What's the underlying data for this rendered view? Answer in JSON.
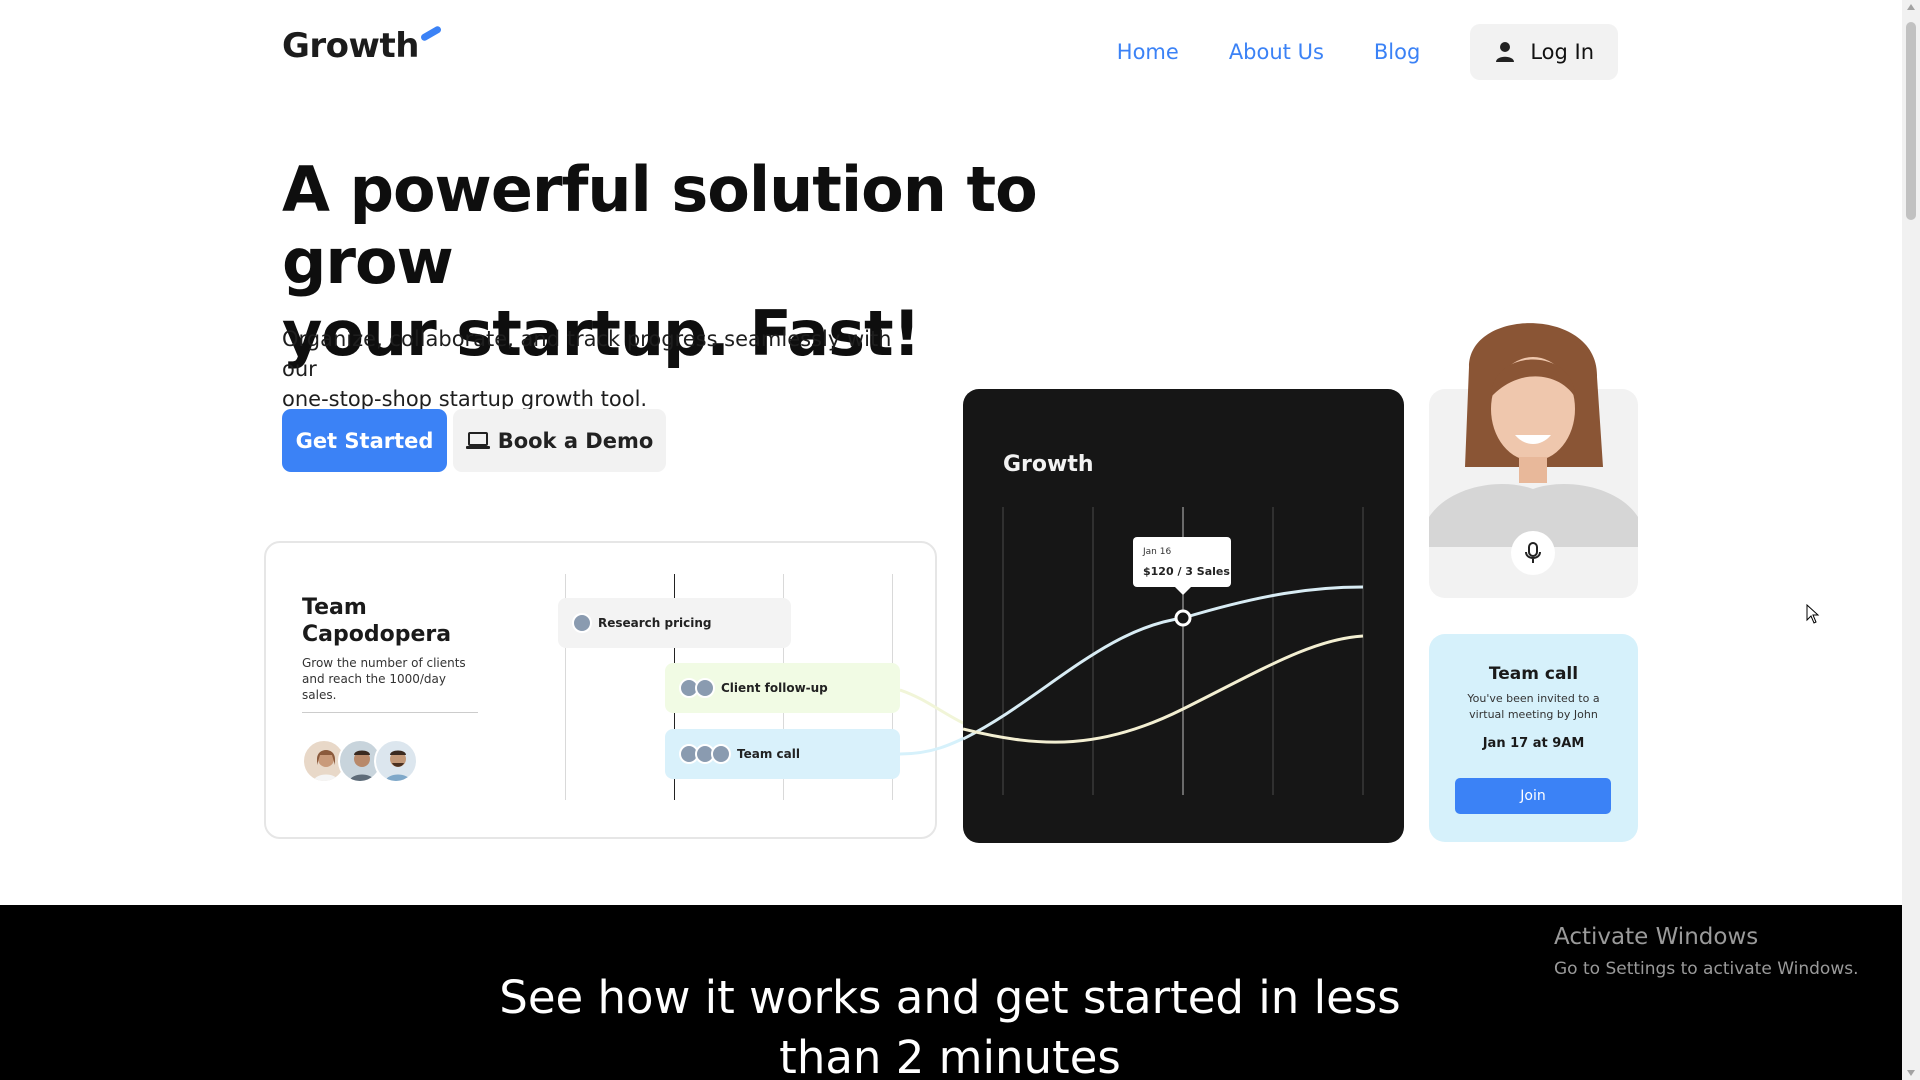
{
  "header": {
    "logo": "Growth",
    "nav": [
      "Home",
      "About Us",
      "Blog"
    ],
    "login_label": "Log In"
  },
  "hero": {
    "title_line1": "A powerful solution to grow",
    "title_line2": "your startup. Fast!",
    "subtitle_line1": "Organize, collaborate, and track progress seamlessly with our",
    "subtitle_line2": "one-stop-shop startup growth tool.",
    "primary_button": "Get Started",
    "secondary_button": "Book a Demo"
  },
  "team_card": {
    "title": "Team Capodopera",
    "description": "Grow the number of clients and reach the 1000/day sales.",
    "tasks": [
      "Research pricing",
      "Client follow-up",
      "Team call"
    ]
  },
  "growth_card": {
    "title": "Growth",
    "tooltip_date": "Jan 16",
    "tooltip_value": "$120 / 3 Sales"
  },
  "call_card": {
    "title": "Team call",
    "description": "You've been invited to a virtual meeting by John",
    "time": "Jan 17 at 9AM",
    "join_label": "Join"
  },
  "section": {
    "title_line1": "See how it works and get started in less",
    "title_line2": "than 2 minutes"
  },
  "windows_watermark": {
    "title": "Activate Windows",
    "subtitle": "Go to Settings to activate Windows."
  },
  "colors": {
    "accent": "#3b82f6",
    "dark": "#161616",
    "call_card_bg": "#d6f1fb"
  }
}
